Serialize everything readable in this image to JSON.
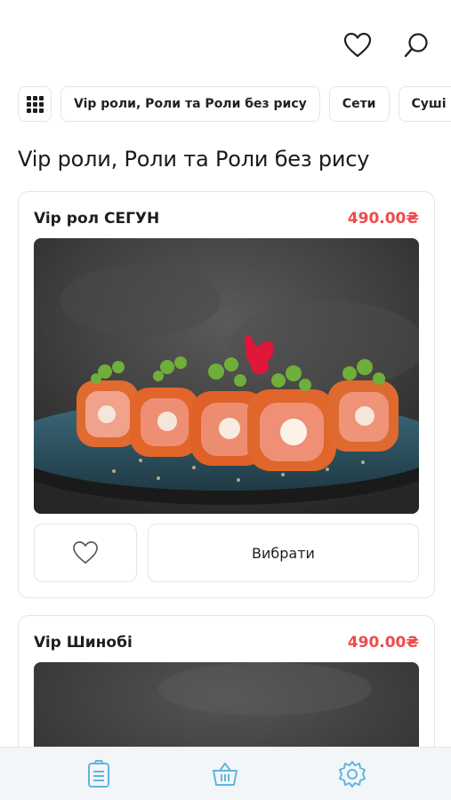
{
  "header": {
    "favorites_icon": "heart-icon",
    "search_icon": "search-icon"
  },
  "categories": {
    "menu_icon": "grid-icon",
    "items": [
      {
        "label": "Vip роли, Роли та Роли без рису"
      },
      {
        "label": "Сети"
      },
      {
        "label": "Суші бургери"
      }
    ]
  },
  "section": {
    "title": "Vip роли, Роли та Роли без рису"
  },
  "products": [
    {
      "name": "Vip рол СЕГУН",
      "price": "490.00₴",
      "favorite_icon": "heart-icon",
      "choose_label": "Вибрати"
    },
    {
      "name": "Vip Шинобі",
      "price": "490.00₴"
    }
  ],
  "bottom_nav": {
    "items": [
      {
        "icon": "menu-list-icon"
      },
      {
        "icon": "basket-icon"
      },
      {
        "icon": "settings-gear-icon"
      }
    ]
  },
  "colors": {
    "price": "#ef4b4b",
    "nav_icon": "#5fb6df",
    "border": "#e1e5ea"
  }
}
